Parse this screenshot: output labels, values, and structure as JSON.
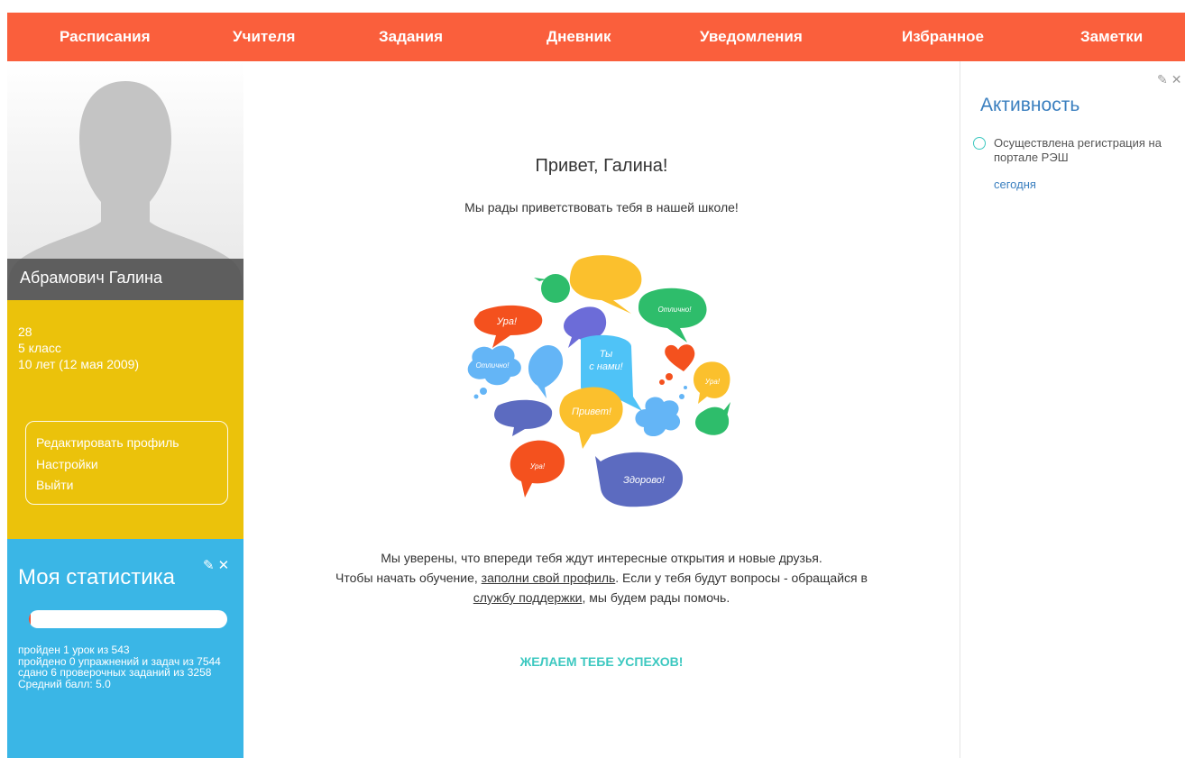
{
  "nav": {
    "items": [
      {
        "label": "Расписания"
      },
      {
        "label": "Учителя"
      },
      {
        "label": "Задания"
      },
      {
        "label": "Дневник"
      },
      {
        "label": "Уведомления"
      },
      {
        "label": "Избранное"
      },
      {
        "label": "Заметки"
      }
    ]
  },
  "profile": {
    "name": "Абрамович Галина",
    "id_number": "28",
    "class": "5 класс",
    "age": "10 лет (12 мая 2009)",
    "menu": {
      "edit": "Редактировать профиль",
      "settings": "Настройки",
      "logout": "Выйти"
    }
  },
  "stats": {
    "title": "Моя статистика",
    "progress": 0.0018,
    "lines": [
      "пройден 1 урок из 543",
      "пройдено 0 упражнений и задач из 7544",
      "сдано 6 проверочных заданий из 3258",
      "Средний балл: 5.0"
    ]
  },
  "main": {
    "greeting": "Привет, Галина!",
    "welcome": "Мы рады приветствовать тебя в нашей школе!",
    "line1": "Мы уверены, что впереди тебя ждут интересные открытия и новые друзья.",
    "line2_pre": "Чтобы начать обучение, ",
    "line2_link": "заполни свой профиль",
    "line2_post": ". Если у тебя будут вопросы - обращайся в",
    "line3_link": "службу поддержки",
    "line3_post": ", мы будем рады помочь.",
    "wish": "ЖЕЛАЕМ ТЕБЕ УСПЕХОВ!"
  },
  "bubbles": {
    "ura1": "Ура!",
    "otlichno1": "Отлично!",
    "otlichno2": "Отлично!",
    "ty_line1": "Ты",
    "ty_line2": "с нами!",
    "ura2": "Ура!",
    "privet": "Привет!",
    "ura3": "Ура!",
    "zdorovo": "Здорово!"
  },
  "activity": {
    "title": "Активность",
    "items": [
      {
        "text": "Осуществлена регистрация на портале РЭШ",
        "date": "сегодня"
      }
    ]
  },
  "icons": {
    "edit": "✎",
    "close": "✕"
  },
  "colors": {
    "nav": "#fa5f3c",
    "profile_info": "#ebc20b",
    "stats": "#3ab6e6",
    "accent_teal": "#3cc8c0",
    "link_blue": "#3a7fbf"
  }
}
